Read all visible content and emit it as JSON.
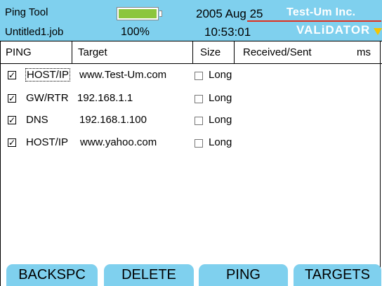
{
  "header": {
    "app_title": "Ping Tool",
    "job_file": "Untitled1.job",
    "battery_percent": "100%",
    "battery_level": 1.0,
    "date": "2005 Aug 25",
    "time": "10:53:01",
    "brand": "Test-Um Inc.",
    "product": "VALiDATOR"
  },
  "columns": {
    "ping": "PING",
    "target": "Target",
    "size": "Size",
    "received_sent": "Received/Sent",
    "ms": "ms"
  },
  "rows": [
    {
      "checked": true,
      "type": "HOST/IP",
      "target": "www.Test-Um.com",
      "size_checked": false,
      "size_label": "Long"
    },
    {
      "checked": true,
      "type": "GW/RTR",
      "target": "192.168.1.1",
      "size_checked": false,
      "size_label": "Long"
    },
    {
      "checked": true,
      "type": "DNS",
      "target": "192.168.1.100",
      "size_checked": false,
      "size_label": "Long"
    },
    {
      "checked": true,
      "type": "HOST/IP",
      "target": "www.yahoo.com",
      "size_checked": false,
      "size_label": "Long"
    }
  ],
  "softkeys": [
    "BACKSPC",
    "DELETE",
    "PING",
    "TARGETS"
  ],
  "colors": {
    "header_bg": "#7fd0ee",
    "softkey_bg": "#7fd0ee",
    "battery_fill": "#8cc63e",
    "brand_line": "#e0301e",
    "product_arrow": "#f5c400"
  },
  "check_glyph": "✓"
}
